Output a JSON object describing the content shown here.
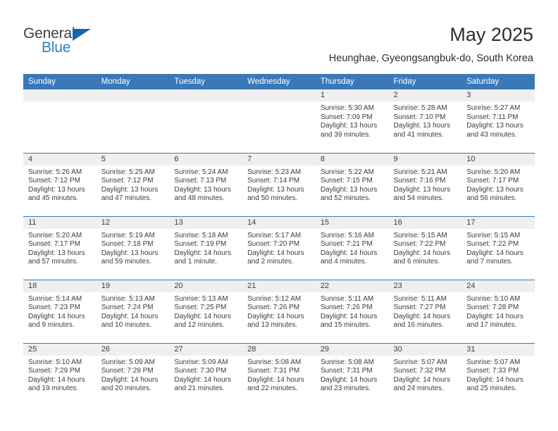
{
  "brand": {
    "name_part1": "General",
    "name_part2": "Blue",
    "triangle_color": "#1267b2",
    "blue_color": "#2a7fc9",
    "dark_color": "#414141"
  },
  "header": {
    "title": "May 2025",
    "subtitle": "Heunghae, Gyeongsangbuk-do, South Korea"
  },
  "theme": {
    "header_row_bg": "#3a79b8",
    "header_row_text": "#ffffff",
    "daynum_band_bg": "#efefef",
    "row_divider": "#3a79b8",
    "body_text": "#3c3c3c"
  },
  "weekday_headers": [
    "Sunday",
    "Monday",
    "Tuesday",
    "Wednesday",
    "Thursday",
    "Friday",
    "Saturday"
  ],
  "weeks": [
    [
      {
        "day": "",
        "empty": true
      },
      {
        "day": "",
        "empty": true
      },
      {
        "day": "",
        "empty": true
      },
      {
        "day": "",
        "empty": true
      },
      {
        "day": "1",
        "sunrise": "Sunrise: 5:30 AM",
        "sunset": "Sunset: 7:09 PM",
        "daylight_line1": "Daylight: 13 hours",
        "daylight_line2": "and 39 minutes."
      },
      {
        "day": "2",
        "sunrise": "Sunrise: 5:28 AM",
        "sunset": "Sunset: 7:10 PM",
        "daylight_line1": "Daylight: 13 hours",
        "daylight_line2": "and 41 minutes."
      },
      {
        "day": "3",
        "sunrise": "Sunrise: 5:27 AM",
        "sunset": "Sunset: 7:11 PM",
        "daylight_line1": "Daylight: 13 hours",
        "daylight_line2": "and 43 minutes."
      }
    ],
    [
      {
        "day": "4",
        "sunrise": "Sunrise: 5:26 AM",
        "sunset": "Sunset: 7:12 PM",
        "daylight_line1": "Daylight: 13 hours",
        "daylight_line2": "and 45 minutes."
      },
      {
        "day": "5",
        "sunrise": "Sunrise: 5:25 AM",
        "sunset": "Sunset: 7:12 PM",
        "daylight_line1": "Daylight: 13 hours",
        "daylight_line2": "and 47 minutes."
      },
      {
        "day": "6",
        "sunrise": "Sunrise: 5:24 AM",
        "sunset": "Sunset: 7:13 PM",
        "daylight_line1": "Daylight: 13 hours",
        "daylight_line2": "and 48 minutes."
      },
      {
        "day": "7",
        "sunrise": "Sunrise: 5:23 AM",
        "sunset": "Sunset: 7:14 PM",
        "daylight_line1": "Daylight: 13 hours",
        "daylight_line2": "and 50 minutes."
      },
      {
        "day": "8",
        "sunrise": "Sunrise: 5:22 AM",
        "sunset": "Sunset: 7:15 PM",
        "daylight_line1": "Daylight: 13 hours",
        "daylight_line2": "and 52 minutes."
      },
      {
        "day": "9",
        "sunrise": "Sunrise: 5:21 AM",
        "sunset": "Sunset: 7:16 PM",
        "daylight_line1": "Daylight: 13 hours",
        "daylight_line2": "and 54 minutes."
      },
      {
        "day": "10",
        "sunrise": "Sunrise: 5:20 AM",
        "sunset": "Sunset: 7:17 PM",
        "daylight_line1": "Daylight: 13 hours",
        "daylight_line2": "and 56 minutes."
      }
    ],
    [
      {
        "day": "11",
        "sunrise": "Sunrise: 5:20 AM",
        "sunset": "Sunset: 7:17 PM",
        "daylight_line1": "Daylight: 13 hours",
        "daylight_line2": "and 57 minutes."
      },
      {
        "day": "12",
        "sunrise": "Sunrise: 5:19 AM",
        "sunset": "Sunset: 7:18 PM",
        "daylight_line1": "Daylight: 13 hours",
        "daylight_line2": "and 59 minutes."
      },
      {
        "day": "13",
        "sunrise": "Sunrise: 5:18 AM",
        "sunset": "Sunset: 7:19 PM",
        "daylight_line1": "Daylight: 14 hours",
        "daylight_line2": "and 1 minute."
      },
      {
        "day": "14",
        "sunrise": "Sunrise: 5:17 AM",
        "sunset": "Sunset: 7:20 PM",
        "daylight_line1": "Daylight: 14 hours",
        "daylight_line2": "and 2 minutes."
      },
      {
        "day": "15",
        "sunrise": "Sunrise: 5:16 AM",
        "sunset": "Sunset: 7:21 PM",
        "daylight_line1": "Daylight: 14 hours",
        "daylight_line2": "and 4 minutes."
      },
      {
        "day": "16",
        "sunrise": "Sunrise: 5:15 AM",
        "sunset": "Sunset: 7:22 PM",
        "daylight_line1": "Daylight: 14 hours",
        "daylight_line2": "and 6 minutes."
      },
      {
        "day": "17",
        "sunrise": "Sunrise: 5:15 AM",
        "sunset": "Sunset: 7:22 PM",
        "daylight_line1": "Daylight: 14 hours",
        "daylight_line2": "and 7 minutes."
      }
    ],
    [
      {
        "day": "18",
        "sunrise": "Sunrise: 5:14 AM",
        "sunset": "Sunset: 7:23 PM",
        "daylight_line1": "Daylight: 14 hours",
        "daylight_line2": "and 9 minutes."
      },
      {
        "day": "19",
        "sunrise": "Sunrise: 5:13 AM",
        "sunset": "Sunset: 7:24 PM",
        "daylight_line1": "Daylight: 14 hours",
        "daylight_line2": "and 10 minutes."
      },
      {
        "day": "20",
        "sunrise": "Sunrise: 5:13 AM",
        "sunset": "Sunset: 7:25 PM",
        "daylight_line1": "Daylight: 14 hours",
        "daylight_line2": "and 12 minutes."
      },
      {
        "day": "21",
        "sunrise": "Sunrise: 5:12 AM",
        "sunset": "Sunset: 7:26 PM",
        "daylight_line1": "Daylight: 14 hours",
        "daylight_line2": "and 13 minutes."
      },
      {
        "day": "22",
        "sunrise": "Sunrise: 5:11 AM",
        "sunset": "Sunset: 7:26 PM",
        "daylight_line1": "Daylight: 14 hours",
        "daylight_line2": "and 15 minutes."
      },
      {
        "day": "23",
        "sunrise": "Sunrise: 5:11 AM",
        "sunset": "Sunset: 7:27 PM",
        "daylight_line1": "Daylight: 14 hours",
        "daylight_line2": "and 16 minutes."
      },
      {
        "day": "24",
        "sunrise": "Sunrise: 5:10 AM",
        "sunset": "Sunset: 7:28 PM",
        "daylight_line1": "Daylight: 14 hours",
        "daylight_line2": "and 17 minutes."
      }
    ],
    [
      {
        "day": "25",
        "sunrise": "Sunrise: 5:10 AM",
        "sunset": "Sunset: 7:29 PM",
        "daylight_line1": "Daylight: 14 hours",
        "daylight_line2": "and 19 minutes."
      },
      {
        "day": "26",
        "sunrise": "Sunrise: 5:09 AM",
        "sunset": "Sunset: 7:29 PM",
        "daylight_line1": "Daylight: 14 hours",
        "daylight_line2": "and 20 minutes."
      },
      {
        "day": "27",
        "sunrise": "Sunrise: 5:09 AM",
        "sunset": "Sunset: 7:30 PM",
        "daylight_line1": "Daylight: 14 hours",
        "daylight_line2": "and 21 minutes."
      },
      {
        "day": "28",
        "sunrise": "Sunrise: 5:08 AM",
        "sunset": "Sunset: 7:31 PM",
        "daylight_line1": "Daylight: 14 hours",
        "daylight_line2": "and 22 minutes."
      },
      {
        "day": "29",
        "sunrise": "Sunrise: 5:08 AM",
        "sunset": "Sunset: 7:31 PM",
        "daylight_line1": "Daylight: 14 hours",
        "daylight_line2": "and 23 minutes."
      },
      {
        "day": "30",
        "sunrise": "Sunrise: 5:07 AM",
        "sunset": "Sunset: 7:32 PM",
        "daylight_line1": "Daylight: 14 hours",
        "daylight_line2": "and 24 minutes."
      },
      {
        "day": "31",
        "sunrise": "Sunrise: 5:07 AM",
        "sunset": "Sunset: 7:33 PM",
        "daylight_line1": "Daylight: 14 hours",
        "daylight_line2": "and 25 minutes."
      }
    ]
  ]
}
